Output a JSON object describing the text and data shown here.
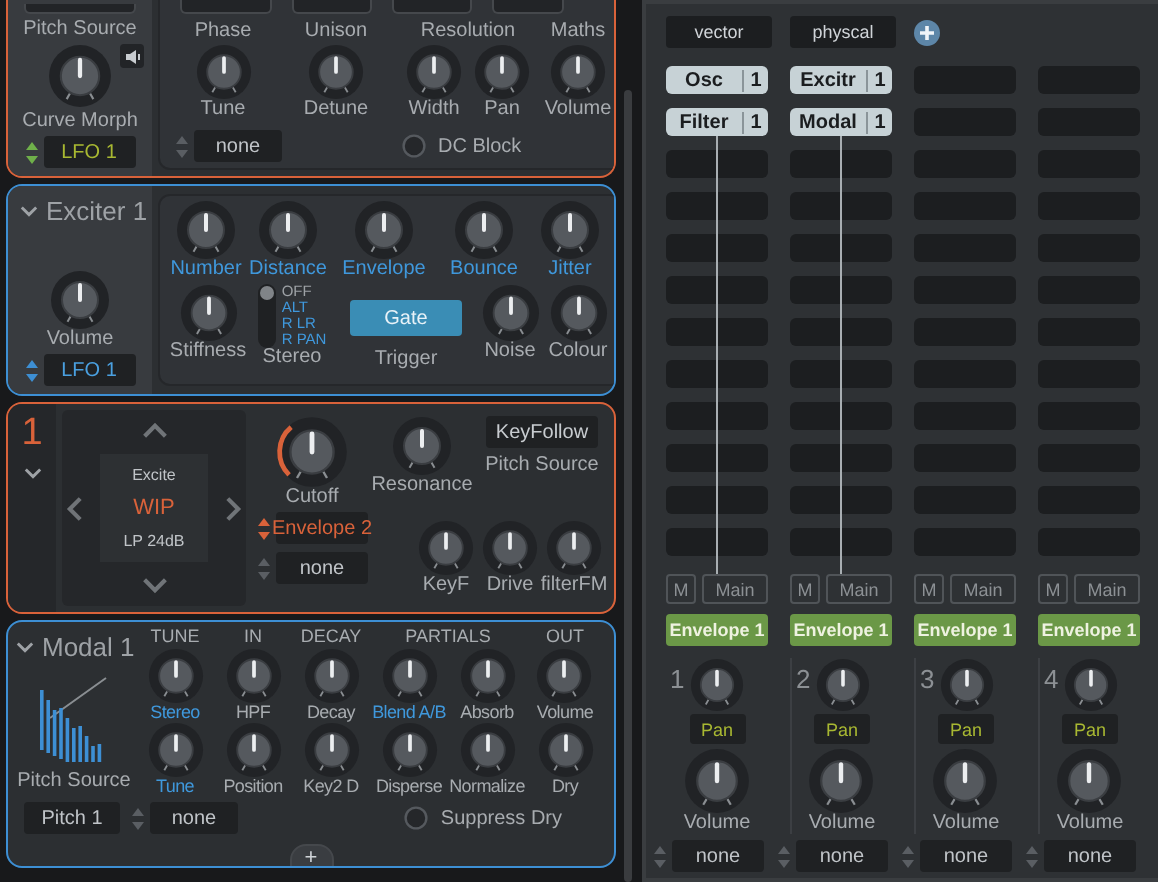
{
  "osc_panel": {
    "pitch_source_label": "Pitch Source",
    "curve_morph": {
      "label": "Curve Morph"
    },
    "source_select": {
      "text": "LFO 1",
      "kind": "green"
    },
    "groups": [
      {
        "header": "Phase",
        "knobs": [
          {
            "label": "Tune"
          }
        ]
      },
      {
        "header": "Unison",
        "knobs": [
          {
            "label": "Detune"
          }
        ]
      },
      {
        "header": "Resolution",
        "knobs": [
          {
            "label": "Width"
          },
          {
            "label": "Pan"
          }
        ]
      },
      {
        "header": "Maths",
        "knobs": [
          {
            "label": "Volume"
          }
        ]
      }
    ],
    "mod_select": {
      "text": "none",
      "kind": "none"
    },
    "dc_block": {
      "label": "DC Block",
      "checked": false
    }
  },
  "exciter_panel": {
    "title": "Exciter 1",
    "volume": {
      "label": "Volume",
      "accent": false
    },
    "source_select": {
      "text": "LFO 1",
      "kind": "blue"
    },
    "top_knobs": [
      {
        "label": "Number",
        "accent": true
      },
      {
        "label": "Distance",
        "accent": true
      },
      {
        "label": "Envelope",
        "accent": true
      },
      {
        "label": "Bounce",
        "accent": true
      },
      {
        "label": "Jitter",
        "accent": true
      }
    ],
    "stiffness": {
      "label": "Stiffness",
      "accent": false
    },
    "stereo": {
      "label": "Stereo",
      "options": [
        {
          "label": "OFF",
          "selected": true
        },
        {
          "label": "ALT",
          "selected": false
        },
        {
          "label": "R LR",
          "selected": false
        },
        {
          "label": "R PAN",
          "selected": false
        }
      ]
    },
    "trigger": {
      "button": "Gate",
      "label": "Trigger"
    },
    "bottom_knobs": [
      {
        "label": "Noise",
        "accent": false
      },
      {
        "label": "Colour",
        "accent": false
      }
    ]
  },
  "filter_panel": {
    "number": "1",
    "selector": {
      "type": "Excite",
      "model": "WIP",
      "mode": "LP 24dB"
    },
    "top_knobs": [
      {
        "label": "Cutoff",
        "modulated": true
      },
      {
        "label": "Resonance",
        "modulated": false
      }
    ],
    "key_follow": {
      "button": "KeyFollow",
      "label": "Pitch Source"
    },
    "selects": [
      {
        "text": "Envelope 2",
        "kind": "orange"
      },
      {
        "text": "none",
        "kind": "none"
      }
    ],
    "bottom_knobs": [
      {
        "label": "KeyF",
        "modulated": false
      },
      {
        "label": "Drive",
        "modulated": false
      },
      {
        "label": "filterFM",
        "modulated": false
      }
    ]
  },
  "modal_panel": {
    "title": "Modal 1",
    "groups": [
      {
        "header": "TUNE",
        "columns": [
          {
            "top": {
              "label": "Stereo",
              "accent": true
            },
            "bottom": {
              "label": "Tune",
              "accent": true
            }
          }
        ]
      },
      {
        "header": "IN",
        "columns": [
          {
            "top": {
              "label": "HPF",
              "accent": false
            },
            "bottom": {
              "label": "Position",
              "accent": false
            }
          }
        ]
      },
      {
        "header": "DECAY",
        "columns": [
          {
            "top": {
              "label": "Decay",
              "accent": false
            },
            "bottom": {
              "label": "Key2 D",
              "accent": false
            }
          }
        ]
      },
      {
        "header": "PARTIALS",
        "columns": [
          {
            "top": {
              "label": "Blend A/B",
              "accent": true
            },
            "bottom": {
              "label": "Disperse",
              "accent": false
            }
          },
          {
            "top": {
              "label": "Absorb",
              "accent": false
            },
            "bottom": {
              "label": "Normalize",
              "accent": false
            }
          }
        ]
      },
      {
        "header": "OUT",
        "columns": [
          {
            "top": {
              "label": "Volume",
              "accent": false
            },
            "bottom": {
              "label": "Dry",
              "accent": false
            }
          }
        ]
      }
    ],
    "pitch_source_label": "Pitch Source",
    "source_select": {
      "text": "Pitch 1",
      "kind": "plain"
    },
    "mod_select": {
      "text": "none",
      "kind": "none"
    },
    "suppress_dry": {
      "label": "Suppress Dry",
      "checked": false
    },
    "add_button": "+"
  },
  "routing_panel": {
    "tabs": [
      {
        "label": "vector"
      },
      {
        "label": "physcal"
      }
    ],
    "columns": [
      {
        "modules": [
          {
            "name": "Osc",
            "index": "1"
          },
          {
            "name": "Filter",
            "index": "1"
          }
        ],
        "mute": "M",
        "output": "Main",
        "envelope": "Envelope 1",
        "number": "1",
        "pan": {
          "label": "Pan"
        },
        "volume": {
          "label": "Volume"
        },
        "mod_select": {
          "text": "none",
          "kind": "none"
        }
      },
      {
        "modules": [
          {
            "name": "Excitr",
            "index": "1"
          },
          {
            "name": "Modal",
            "index": "1"
          }
        ],
        "mute": "M",
        "output": "Main",
        "envelope": "Envelope 1",
        "number": "2",
        "pan": {
          "label": "Pan"
        },
        "volume": {
          "label": "Volume"
        },
        "mod_select": {
          "text": "none",
          "kind": "none"
        }
      },
      {
        "mute": "M",
        "output": "Main",
        "envelope": "Envelope 1",
        "number": "3",
        "pan": {
          "label": "Pan"
        },
        "volume": {
          "label": "Volume"
        },
        "mod_select": {
          "text": "none",
          "kind": "none"
        }
      },
      {
        "mute": "M",
        "output": "Main",
        "envelope": "Envelope 1",
        "number": "4",
        "pan": {
          "label": "Pan"
        },
        "volume": {
          "label": "Volume"
        },
        "mod_select": {
          "text": "none",
          "kind": "none"
        }
      }
    ]
  }
}
